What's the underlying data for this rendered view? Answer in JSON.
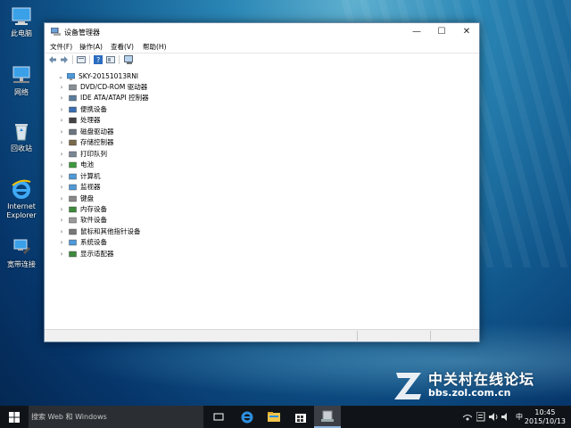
{
  "desktop": {
    "icons": [
      {
        "label": "此电脑",
        "icon": "computer-icon"
      },
      {
        "label": "网络",
        "icon": "network-icon"
      },
      {
        "label": "回收站",
        "icon": "recycle-bin-icon"
      },
      {
        "label": "Internet Explorer",
        "icon": "ie-icon"
      },
      {
        "label": "宽带连接",
        "icon": "broadband-icon"
      }
    ]
  },
  "window": {
    "title": "设备管理器",
    "controls": {
      "minimize": "—",
      "maximize": "☐",
      "close": "✕"
    },
    "menu": [
      "文件(F)",
      "操作(A)",
      "查看(V)",
      "帮助(H)"
    ],
    "toolbar": [
      "back-icon",
      "forward-icon",
      "properties-icon",
      "help-icon",
      "view-icon",
      "scan-icon"
    ],
    "tree": {
      "root": "SKY-20151013RNI",
      "items": [
        {
          "label": "DVD/CD-ROM 驱动器",
          "icon": "dvd-drive-icon"
        },
        {
          "label": "IDE ATA/ATAPI 控制器",
          "icon": "ide-controller-icon"
        },
        {
          "label": "便携设备",
          "icon": "portable-device-icon"
        },
        {
          "label": "处理器",
          "icon": "processor-icon"
        },
        {
          "label": "磁盘驱动器",
          "icon": "disk-drive-icon"
        },
        {
          "label": "存储控制器",
          "icon": "storage-controller-icon"
        },
        {
          "label": "打印队列",
          "icon": "print-queue-icon"
        },
        {
          "label": "电池",
          "icon": "battery-icon"
        },
        {
          "label": "计算机",
          "icon": "computer-icon"
        },
        {
          "label": "监视器",
          "icon": "monitor-icon"
        },
        {
          "label": "键盘",
          "icon": "keyboard-icon"
        },
        {
          "label": "内存设备",
          "icon": "memory-device-icon"
        },
        {
          "label": "软件设备",
          "icon": "software-device-icon"
        },
        {
          "label": "鼠标和其他指针设备",
          "icon": "mouse-icon"
        },
        {
          "label": "系统设备",
          "icon": "system-device-icon"
        },
        {
          "label": "显示适配器",
          "icon": "display-adapter-icon"
        }
      ]
    }
  },
  "taskbar": {
    "search_placeholder": "搜索 Web 和 Windows",
    "apps": [
      "task-view-icon",
      "edge-icon",
      "file-explorer-icon",
      "store-icon",
      "device-manager-icon"
    ],
    "tray": {
      "ime": "中"
    },
    "clock": {
      "time": "10:45",
      "date": "2015/10/13"
    }
  },
  "watermark": {
    "line1": "中关村在线论坛",
    "line2": "bbs.zol.com.cn"
  }
}
